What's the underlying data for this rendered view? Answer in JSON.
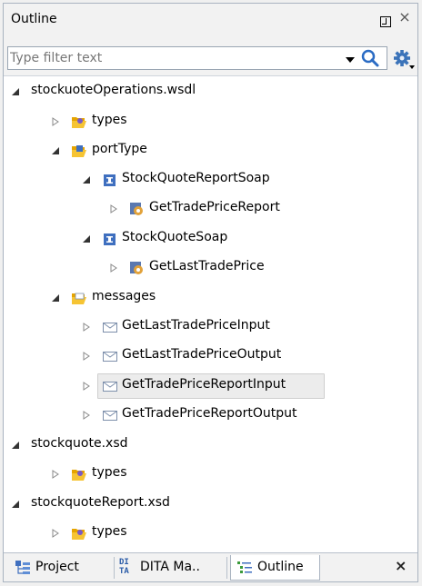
{
  "panel": {
    "title": "Outline",
    "close_glyph": "×"
  },
  "filter": {
    "placeholder": "Type filter text",
    "value": ""
  },
  "tree": {
    "root1": {
      "label": "stockuoteOperations.wsdl"
    },
    "types1": {
      "label": "types"
    },
    "porttype": {
      "label": "portType"
    },
    "sqrs": {
      "label": "StockQuoteReportSoap"
    },
    "gtpr": {
      "label": "GetTradePriceReport"
    },
    "sqs": {
      "label": "StockQuoteSoap"
    },
    "gltp": {
      "label": "GetLastTradePrice"
    },
    "messages": {
      "label": "messages"
    },
    "m1": {
      "label": "GetLastTradePriceInput"
    },
    "m2": {
      "label": "GetLastTradePriceOutput"
    },
    "m3": {
      "label": "GetTradePriceReportInput"
    },
    "m4": {
      "label": "GetTradePriceReportOutput"
    },
    "root2": {
      "label": "stockquote.xsd"
    },
    "types2": {
      "label": "types"
    },
    "root3": {
      "label": "stockquoteReport.xsd"
    },
    "types3": {
      "label": "types"
    }
  },
  "tabs": {
    "project": "Project",
    "dita_icon": "DI\nTA",
    "dita": "DITA Ma..",
    "outline": "Outline",
    "close_glyph": "×"
  },
  "colors": {
    "selection": "#ececec",
    "folder": "#f0b400",
    "interface_icon": "#3f6fbf"
  }
}
